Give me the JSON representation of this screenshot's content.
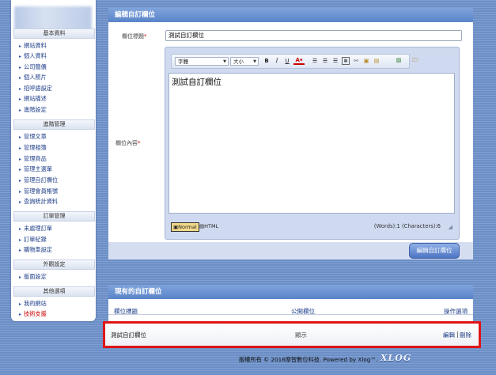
{
  "sidebar": {
    "sections": [
      {
        "title": "基本資料",
        "items": [
          "網站資料",
          "個人資料",
          "公司簡價",
          "個人照片",
          "招呼語設定",
          "網站描述",
          "進階設定"
        ]
      },
      {
        "title": "進階管理",
        "items": [
          "管理文章",
          "管理相簿",
          "管理商品",
          "管理主選單",
          "管理自訂欄位",
          "管理會員帳號",
          "查詢統計資料"
        ]
      },
      {
        "title": "訂單管理",
        "items": [
          "未處理訂單",
          "訂單紀錄",
          "購物車設定"
        ]
      },
      {
        "title": "外觀設定",
        "items": [
          "版面設定"
        ]
      },
      {
        "title": "其他選項",
        "items": [
          "我的網站",
          "技術支援"
        ]
      }
    ]
  },
  "edit_panel": {
    "title": "編輯自訂欄位",
    "field_title_label": "欄位標題",
    "field_title_value": "測試自訂欄位",
    "field_content_label": "欄位內容",
    "editor": {
      "font_select": "字體",
      "size_select": "大小",
      "content": "測試自訂欄位",
      "mode_normal": "Normal",
      "mode_html": "HTML",
      "word_count": "(Words):1 (Characters):6"
    },
    "submit_label": "編輯自訂欄位"
  },
  "list_panel": {
    "title": "現有的自訂欄位",
    "columns": [
      "欄位標題",
      "公開欄位",
      "操作選項"
    ],
    "rows": [
      {
        "title": "測試自訂欄位",
        "public": "顯示",
        "edit": "編輯",
        "sep": "|",
        "delete": "刪除"
      }
    ]
  },
  "footer": {
    "copyright": "版權所有 © 2016摩智數位科技. Powered by Xlog™.",
    "logo": "XLOG"
  },
  "colors": {
    "accent": "#5a84c9",
    "highlight": "#e01515",
    "link": "#1f3f8a"
  }
}
